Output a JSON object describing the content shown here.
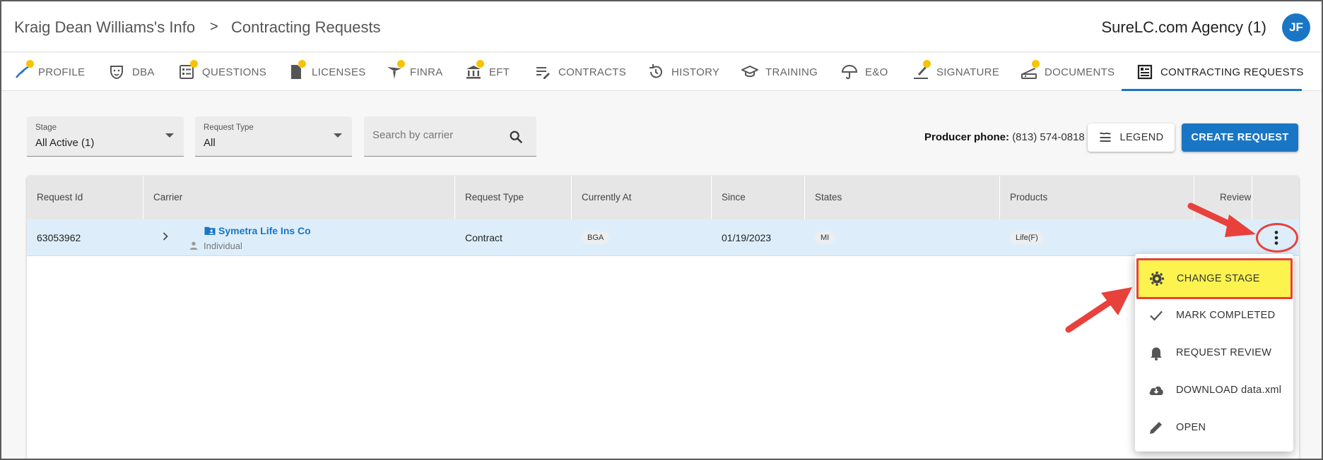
{
  "header": {
    "breadcrumb_1": "Kraig Dean Williams's Info",
    "breadcrumb_sep": ">",
    "breadcrumb_2": "Contracting Requests",
    "agency": "SureLC.com Agency (1)",
    "avatar_initials": "JF"
  },
  "tabs": [
    {
      "label": "PROFILE",
      "icon": "profile-icon",
      "dot": true
    },
    {
      "label": "DBA",
      "icon": "mask-icon",
      "dot": false
    },
    {
      "label": "QUESTIONS",
      "icon": "checklist-icon",
      "dot": true
    },
    {
      "label": "LICENSES",
      "icon": "document-icon",
      "dot": true
    },
    {
      "label": "FINRA",
      "icon": "finra-icon",
      "dot": true
    },
    {
      "label": "EFT",
      "icon": "bank-icon",
      "dot": true
    },
    {
      "label": "CONTRACTS",
      "icon": "edit-list-icon",
      "dot": false
    },
    {
      "label": "HISTORY",
      "icon": "history-icon",
      "dot": false
    },
    {
      "label": "TRAINING",
      "icon": "graduation-cap-icon",
      "dot": false
    },
    {
      "label": "E&O",
      "icon": "umbrella-icon",
      "dot": false
    },
    {
      "label": "SIGNATURE",
      "icon": "pen-icon",
      "dot": true
    },
    {
      "label": "DOCUMENTS",
      "icon": "scanner-icon",
      "dot": true
    },
    {
      "label": "CONTRACTING REQUESTS",
      "icon": "dashboard-icon",
      "dot": false,
      "active": true
    }
  ],
  "filters": {
    "stage_label": "Stage",
    "stage_value": "All Active (1)",
    "type_label": "Request Type",
    "type_value": "All",
    "search_placeholder": "Search by carrier"
  },
  "producer": {
    "phone_label": "Producer phone:",
    "phone_value": "(813) 574-0818"
  },
  "buttons": {
    "legend": "LEGEND",
    "create": "CREATE REQUEST"
  },
  "table": {
    "columns": [
      "Request Id",
      "Carrier",
      "Request Type",
      "Currently At",
      "Since",
      "States",
      "Products",
      "Reviewe"
    ],
    "row": {
      "request_id": "63053962",
      "carrier": "Symetra Life Ins Co",
      "carrier_sub": "Individual",
      "request_type": "Contract",
      "currently_at": "BGA",
      "since": "01/19/2023",
      "states": "MI",
      "products": "Life(F)"
    }
  },
  "menu": [
    {
      "label": "CHANGE STAGE",
      "icon": "gear-icon"
    },
    {
      "label": "MARK COMPLETED",
      "icon": "check-icon"
    },
    {
      "label": "REQUEST REVIEW",
      "icon": "bell-icon"
    },
    {
      "label": "DOWNLOAD data.xml",
      "icon": "cloud-download-icon"
    },
    {
      "label": "OPEN",
      "icon": "pencil-icon"
    }
  ],
  "colors": {
    "accent": "#1976c5",
    "dot": "#f7c400",
    "row_selected": "#ddeefa",
    "annotation_red": "#e8413c",
    "highlight_yellow": "#fdf34f"
  }
}
